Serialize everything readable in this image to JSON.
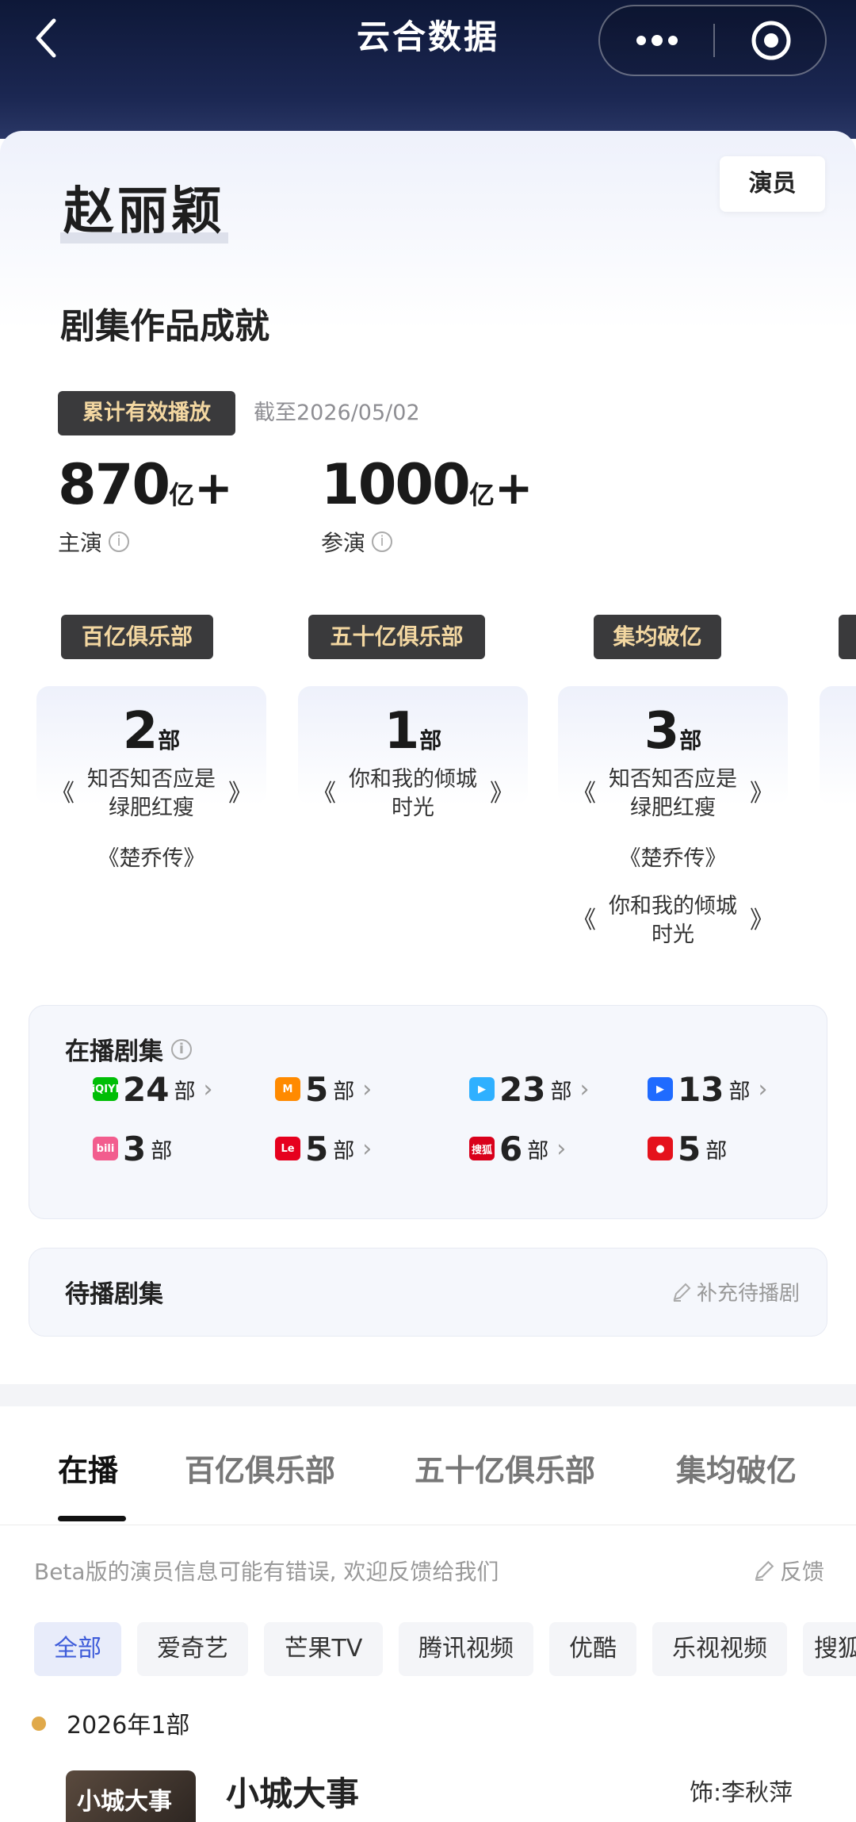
{
  "nav": {
    "title": "云合数据"
  },
  "profile": {
    "name": "赵丽颖",
    "role_tag": "演员"
  },
  "achievements": {
    "heading": "剧集作品成就",
    "badge": "累计有效播放",
    "as_of": "截至2026/05/02",
    "lead": {
      "value": "870",
      "unit": "亿",
      "plus": "+",
      "label": "主演"
    },
    "support": {
      "value": "1000",
      "unit": "亿",
      "plus": "+",
      "label": "参演"
    },
    "info_glyph": "i"
  },
  "clubs": [
    {
      "badge": "百亿俱乐部",
      "count": "2",
      "unit": "部",
      "works": [
        {
          "title": "知否知否应是\n绿肥红瘦",
          "bracketed": true
        },
        {
          "title": "《楚乔传》",
          "bracketed": false
        }
      ]
    },
    {
      "badge": "五十亿俱乐部",
      "count": "1",
      "unit": "部",
      "works": [
        {
          "title": "你和我的倾城\n时光",
          "bracketed": true
        }
      ]
    },
    {
      "badge": "集均破亿",
      "count": "3",
      "unit": "部",
      "works": [
        {
          "title": "知否知否应是\n绿肥红瘦",
          "bracketed": true
        },
        {
          "title": "《楚乔传》",
          "bracketed": false
        },
        {
          "title": "你和我的倾城\n时光",
          "bracketed": true
        }
      ]
    }
  ],
  "airing": {
    "title": "在播剧集",
    "platforms": [
      {
        "icon": "iqiyi-icon",
        "logo_text": "iQIYI",
        "color": "#00be06",
        "count": "24",
        "unit": "部",
        "chevron": true
      },
      {
        "icon": "mango-tv-icon",
        "logo_text": "M",
        "color": "#ff8a00",
        "count": "5",
        "unit": "部",
        "chevron": true
      },
      {
        "icon": "tencent-video-icon",
        "logo_text": "▶",
        "color": "#2fb0ff",
        "count": "23",
        "unit": "部",
        "chevron": true
      },
      {
        "icon": "youku-icon",
        "logo_text": "▶",
        "color": "#1f6bff",
        "count": "13",
        "unit": "部",
        "chevron": true
      },
      {
        "icon": "bilibili-icon",
        "logo_text": "bili",
        "color": "#f25d8e",
        "count": "3",
        "unit": "部",
        "chevron": false
      },
      {
        "icon": "letv-icon",
        "logo_text": "Le",
        "color": "#e6001e",
        "count": "5",
        "unit": "部",
        "chevron": true
      },
      {
        "icon": "sohu-video-icon",
        "logo_text": "搜狐",
        "color": "#d9001b",
        "count": "6",
        "unit": "部",
        "chevron": true
      },
      {
        "icon": "pptv-icon",
        "logo_text": "●",
        "color": "#e5121c",
        "count": "5",
        "unit": "部",
        "chevron": false
      }
    ]
  },
  "upcoming": {
    "title": "待播剧集",
    "add_label": "补充待播剧"
  },
  "tabs": [
    "在播",
    "百亿俱乐部",
    "五十亿俱乐部",
    "集均破亿"
  ],
  "beta_note": "Beta版的演员信息可能有错误, 欢迎反馈给我们",
  "feedback_label": "反馈",
  "filters": [
    "全部",
    "爱奇艺",
    "芒果TV",
    "腾讯视频",
    "优酷",
    "乐视视频",
    "搜狐"
  ],
  "year_group": {
    "label": "2026年1部"
  },
  "show": {
    "thumb_text": "小城大事",
    "title": "小城大事",
    "role": "饰:李秋萍"
  },
  "colors": {
    "nav_bg": "#0e1838",
    "badge_bg": "#3a3a3c",
    "badge_text": "#f3d7a1",
    "accent": "#3d5bd9",
    "year_dot": "#e0a94a"
  }
}
